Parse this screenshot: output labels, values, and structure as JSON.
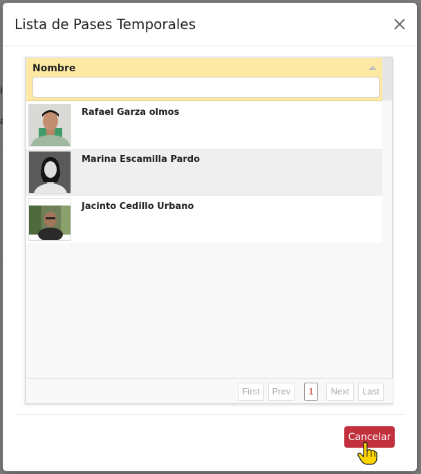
{
  "modal": {
    "title": "Lista de Pases Temporales",
    "close_icon": "close-icon"
  },
  "background": {
    "char1": "i",
    "char2": "a:"
  },
  "grid": {
    "column_header": "Nombre",
    "sort_icon": "sort-up-icon",
    "filter": {
      "value": "",
      "placeholder": ""
    },
    "rows": [
      {
        "name": "Rafael Garza olmos",
        "photo": "person-photo"
      },
      {
        "name": "Marina Escamilla Pardo",
        "photo": "person-photo"
      },
      {
        "name": "Jacinto Cedillo Urbano",
        "photo": "person-photo"
      }
    ],
    "pager": {
      "first": "First",
      "prev": "Prev",
      "page": "1",
      "next": "Next",
      "last": "Last"
    }
  },
  "footer": {
    "cancel_label": "Cancelar"
  },
  "colors": {
    "header_bg": "#fde9a4",
    "cancel_bg": "#c1303c",
    "active_page": "#c0392b"
  }
}
